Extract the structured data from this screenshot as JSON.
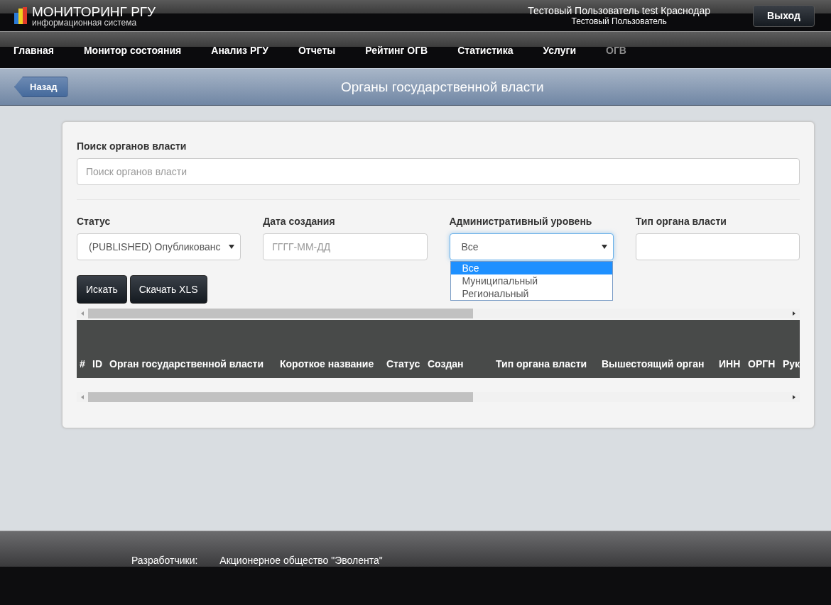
{
  "header": {
    "logo_title": "МОНИТОРИНГ РГУ",
    "logo_subtitle": "информационная система",
    "user_line": "Тестовый Пользователь test Краснодар",
    "user_role": "Тестовый Пользователь",
    "logout": "Выход"
  },
  "nav": [
    {
      "label": "Главная",
      "selected": false
    },
    {
      "label": "Монитор состояния",
      "selected": false
    },
    {
      "label": "Анализ РГУ",
      "selected": false
    },
    {
      "label": "Отчеты",
      "selected": false
    },
    {
      "label": "Рейтинг ОГВ",
      "selected": false
    },
    {
      "label": "Статистика",
      "selected": false
    },
    {
      "label": "Услуги",
      "selected": false
    },
    {
      "label": "ОГВ",
      "selected": true
    }
  ],
  "title_bar": {
    "back": "Назад",
    "title": "Органы государственной власти"
  },
  "search": {
    "label": "Поиск органов власти",
    "placeholder": "Поиск органов власти"
  },
  "filters": [
    {
      "kind": "select",
      "label": "Статус",
      "value": "(PUBLISHED) Опубликованс"
    },
    {
      "kind": "input",
      "label": "Дата создания",
      "placeholder": "ГГГГ-ММ-ДД"
    },
    {
      "kind": "select",
      "label": "Административный уровень",
      "value": "Все",
      "open": true,
      "options": [
        {
          "label": "Все",
          "selected": true
        },
        {
          "label": "Муниципальный",
          "selected": false
        },
        {
          "label": "Региональный",
          "selected": false
        }
      ]
    },
    {
      "kind": "input",
      "label": "Тип органа власти"
    }
  ],
  "buttons": [
    "Искать",
    "Скачать XLS"
  ],
  "table": {
    "columns": [
      "#",
      "ID",
      "Орган государственной власти",
      "Короткое название",
      "Статус",
      "Создан",
      "Тип органа власти",
      "Вышестоящий орган",
      "ИНН",
      "ОРГН",
      "Рук"
    ]
  },
  "footer": {
    "label": "Разработчики:",
    "value": "Акционерное общество \"Эволента\""
  }
}
